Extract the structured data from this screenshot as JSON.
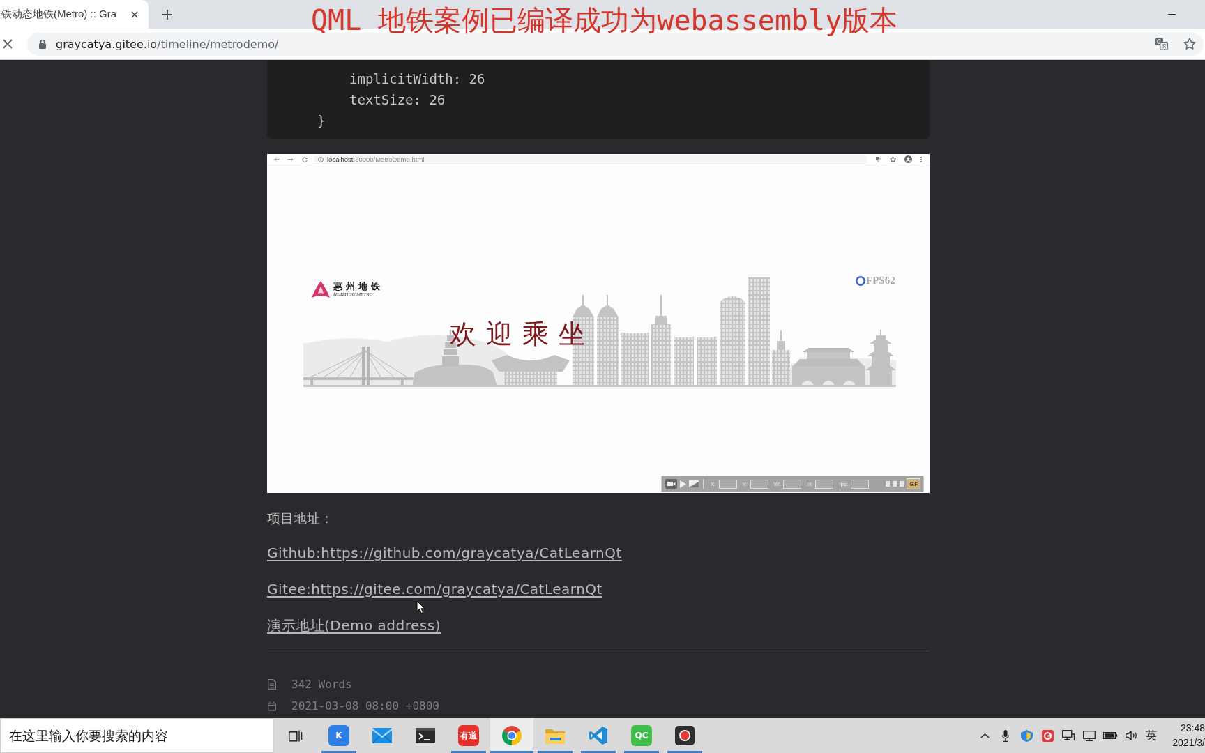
{
  "browser": {
    "tabs": [
      {
        "title": "铁动态地铁(Metro) :: Gra",
        "selected": true
      }
    ],
    "address": {
      "host": "graycatya.gitee.io",
      "path": "/timeline/metrodemo/"
    }
  },
  "caption": "QML 地铁案例已编译成功为webassembly版本",
  "code_block": {
    "body": [
      "implicitWidth: 26",
      "textSize: 26"
    ],
    "closing": "}"
  },
  "screenshot": {
    "address": {
      "host": "localhost",
      "path": ":30000/MetroDemo.html"
    },
    "logo": {
      "title": "惠州地铁",
      "subtitle": "HUIZHOU METRO"
    },
    "welcome": "欢迎乘坐",
    "fps": "FPS62",
    "recorder": {
      "fields": [
        {
          "label": "X:"
        },
        {
          "label": "Y:"
        },
        {
          "label": "W:"
        },
        {
          "label": "H:"
        },
        {
          "label": "fps:"
        }
      ],
      "gif_button": "GIF"
    }
  },
  "project": {
    "heading": "项目地址：",
    "links": [
      "Github:https://github.com/graycatya/CatLearnQt",
      "Gitee:https://gitee.com/graycatya/CatLearnQt",
      "演示地址(Demo address)"
    ]
  },
  "meta": [
    {
      "kind": "words",
      "text": "342 Words"
    },
    {
      "kind": "date",
      "text": "2021-03-08 08:00 +0800"
    }
  ],
  "taskbar": {
    "search": {
      "placeholder": "在这里输入你要搜索的内容"
    },
    "apps": [
      {
        "kind": "taskview",
        "selected": false,
        "running": false
      },
      {
        "kind": "tile",
        "label": "K",
        "color": "#2f7fe6",
        "selected": false,
        "running": true
      },
      {
        "kind": "mail",
        "selected": false,
        "running": false
      },
      {
        "kind": "terminal",
        "selected": false,
        "running": false
      },
      {
        "kind": "tile",
        "label": "有道",
        "color": "#e4312d",
        "selected": false,
        "running": true
      },
      {
        "kind": "browser",
        "selected": true,
        "running": true
      },
      {
        "kind": "folder",
        "selected": false,
        "running": true
      },
      {
        "kind": "editor",
        "selected": false,
        "running": true
      },
      {
        "kind": "tile",
        "label": "QC",
        "color": "#3fbf4a",
        "selected": false,
        "running": true
      },
      {
        "kind": "recorder",
        "selected": false,
        "running": true
      }
    ],
    "tray": {
      "ime": "英",
      "time": "23:48",
      "date": "2021/3/"
    }
  }
}
